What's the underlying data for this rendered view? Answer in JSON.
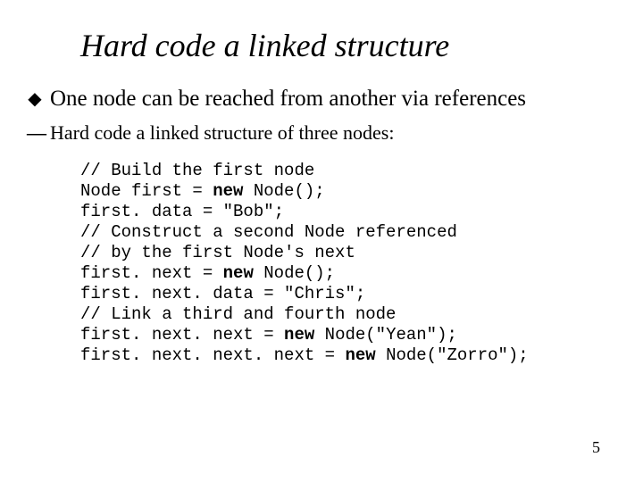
{
  "title": "Hard code a linked structure",
  "bullet": {
    "symbol": "◆",
    "text": "One node can be reached from another via references"
  },
  "subbullet": {
    "symbol": "—",
    "text": "Hard code a linked structure of three nodes:"
  },
  "code": [
    {
      "pre": "// Build the first node",
      "kw": "",
      "post": ""
    },
    {
      "pre": "Node first = ",
      "kw": "new",
      "post": " Node();"
    },
    {
      "pre": "first. data = \"Bob\";",
      "kw": "",
      "post": ""
    },
    {
      "pre": "// Construct a second Node referenced",
      "kw": "",
      "post": ""
    },
    {
      "pre": "// by the first Node's next",
      "kw": "",
      "post": ""
    },
    {
      "pre": "first. next = ",
      "kw": "new",
      "post": " Node();"
    },
    {
      "pre": "first. next. data = \"Chris\";",
      "kw": "",
      "post": ""
    },
    {
      "pre": "// Link a third and fourth node",
      "kw": "",
      "post": ""
    },
    {
      "pre": "first. next. next = ",
      "kw": "new",
      "post": " Node(\"Yean\");"
    },
    {
      "pre": "first. next. next. next = ",
      "kw": "new",
      "post": " Node(\"Zorro\");"
    }
  ],
  "page_number": "5"
}
